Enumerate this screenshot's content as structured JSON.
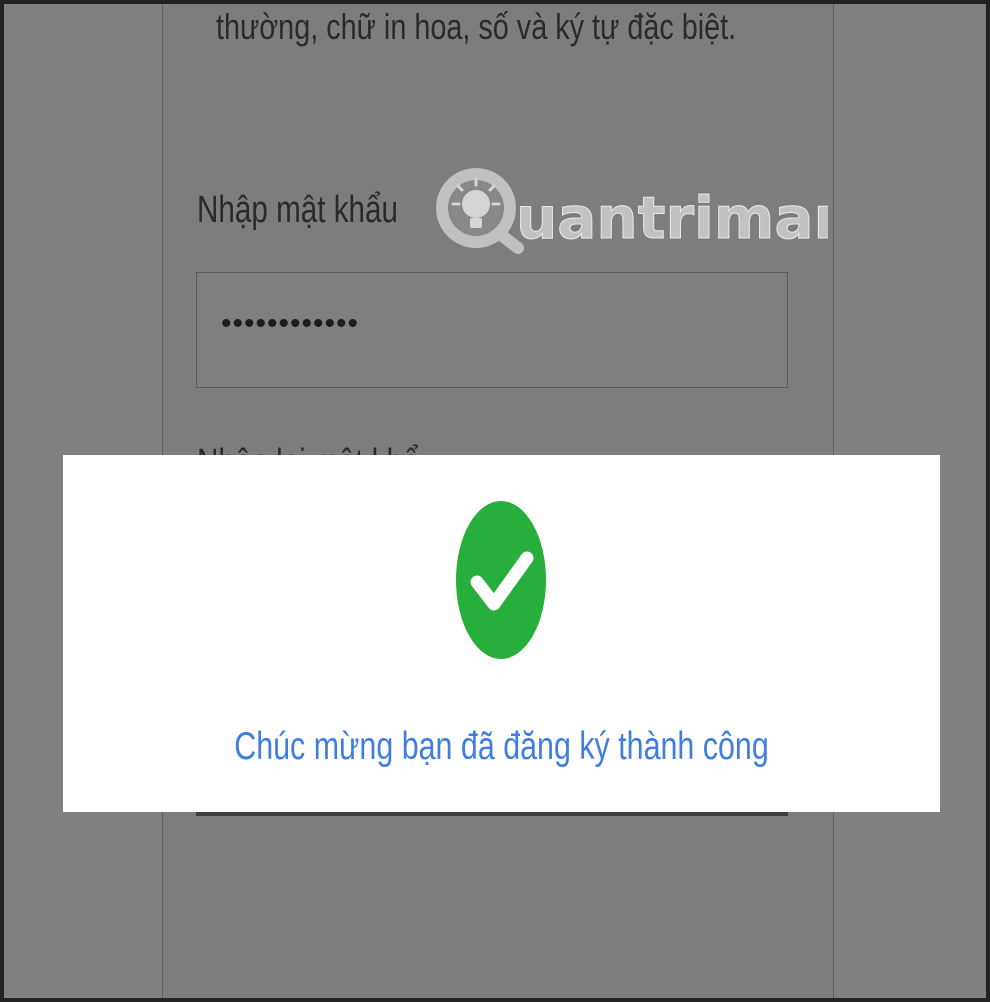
{
  "form": {
    "hint_text": "thường, chữ in hoa, số và ký tự đặc biệt.",
    "password_label": "Nhập mật khẩu",
    "password_value": "••••••••••••",
    "confirm_label": "Nhập lại mật khẩu"
  },
  "watermark": {
    "brand": "Quantrimang"
  },
  "modal": {
    "icon": "check-circle-icon",
    "message": "Chúc mừng bạn đã đăng ký thành công"
  },
  "colors": {
    "success": "#27ae3c",
    "message": "#3f7ee0",
    "overlay": "#808080"
  }
}
